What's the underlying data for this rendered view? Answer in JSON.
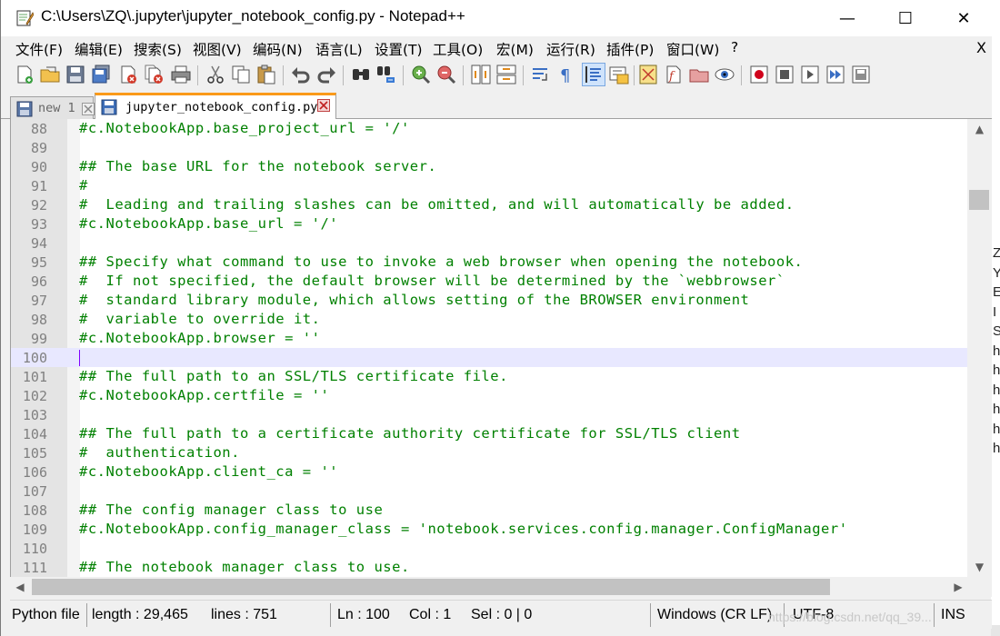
{
  "window": {
    "title": "C:\\Users\\ZQ\\.jupyter\\jupyter_notebook_config.py - Notepad++",
    "minimize_glyph": "—",
    "maximize_glyph": "☐",
    "close_glyph": "✕"
  },
  "menu": {
    "items": [
      "文件(F)",
      "编辑(E)",
      "搜索(S)",
      "视图(V)",
      "编码(N)",
      "语言(L)",
      "设置(T)",
      "工具(O)",
      "宏(M)",
      "运行(R)",
      "插件(P)",
      "窗口(W)",
      "?"
    ],
    "close_glyph": "X"
  },
  "toolbar": {
    "icons": [
      "new-file-icon",
      "open-file-icon",
      "save-icon",
      "save-all-icon",
      "close-icon",
      "close-all-icon",
      "print-icon",
      "cut-icon",
      "copy-icon",
      "paste-icon",
      "undo-icon",
      "redo-icon",
      "find-icon",
      "replace-icon",
      "zoom-in-icon",
      "zoom-out-icon",
      "sync-vertical-icon",
      "sync-horizontal-icon",
      "word-wrap-icon",
      "show-all-chars-icon",
      "indent-guide-icon",
      "language-udl-icon",
      "document-map-icon",
      "function-list-icon",
      "folder-workspace-icon",
      "monitoring-icon",
      "record-macro-icon",
      "stop-macro-icon",
      "play-macro-icon",
      "run-macro-multiple-icon",
      "save-macro-icon"
    ]
  },
  "tabs": [
    {
      "label": "new 1",
      "active": false
    },
    {
      "label": "jupyter_notebook_config.py",
      "active": true
    }
  ],
  "editor": {
    "current_line": 100,
    "lines": [
      {
        "n": "88",
        "text": "#c.NotebookApp.base_project_url = '/'"
      },
      {
        "n": "89",
        "text": ""
      },
      {
        "n": "90",
        "text": "## The base URL for the notebook server."
      },
      {
        "n": "91",
        "text": "#"
      },
      {
        "n": "92",
        "text": "#  Leading and trailing slashes can be omitted, and will automatically be added."
      },
      {
        "n": "93",
        "text": "#c.NotebookApp.base_url = '/'"
      },
      {
        "n": "94",
        "text": ""
      },
      {
        "n": "95",
        "text": "## Specify what command to use to invoke a web browser when opening the notebook."
      },
      {
        "n": "96",
        "text": "#  If not specified, the default browser will be determined by the `webbrowser`"
      },
      {
        "n": "97",
        "text": "#  standard library module, which allows setting of the BROWSER environment"
      },
      {
        "n": "98",
        "text": "#  variable to override it."
      },
      {
        "n": "99",
        "text": "#c.NotebookApp.browser = ''"
      },
      {
        "n": "100",
        "text": ""
      },
      {
        "n": "101",
        "text": "## The full path to an SSL/TLS certificate file."
      },
      {
        "n": "102",
        "text": "#c.NotebookApp.certfile = ''"
      },
      {
        "n": "103",
        "text": ""
      },
      {
        "n": "104",
        "text": "## The full path to a certificate authority certificate for SSL/TLS client"
      },
      {
        "n": "105",
        "text": "#  authentication."
      },
      {
        "n": "106",
        "text": "#c.NotebookApp.client_ca = ''"
      },
      {
        "n": "107",
        "text": ""
      },
      {
        "n": "108",
        "text": "## The config manager class to use"
      },
      {
        "n": "109",
        "text": "#c.NotebookApp.config_manager_class = 'notebook.services.config.manager.ConfigManager'"
      },
      {
        "n": "110",
        "text": ""
      },
      {
        "n": "111",
        "text": "## The notebook manager class to use."
      }
    ]
  },
  "scroll": {
    "up": "▲",
    "down": "▼",
    "left": "◀",
    "right": "▶"
  },
  "status": {
    "file_type": "Python file",
    "length": "length : 29,465",
    "lines": "lines : 751",
    "ln": "Ln : 100",
    "col": "Col : 1",
    "sel": "Sel : 0 | 0",
    "eol": "Windows (CR LF)",
    "encoding": "UTF-8",
    "mode": "INS"
  },
  "watermark": "https://blog.csdn.net/qq_39...",
  "background": {
    "right_text": "Z\nY\nE\nI\nS\nh\nh\nh\nh\nh\nh",
    "left_chars": [
      "e",
      "g"
    ]
  },
  "colors": {
    "comment_green": "#008000",
    "current_line": "#e8e8ff",
    "tab_accent": "#fa9a19",
    "caret": "#8000ff"
  }
}
